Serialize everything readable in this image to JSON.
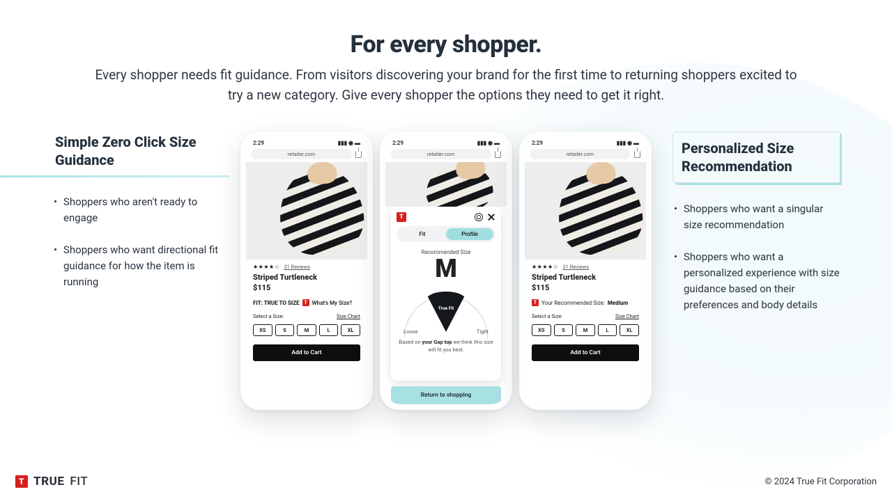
{
  "heading": {
    "title": "For every shopper.",
    "subtitle": "Every shopper needs fit guidance. From visitors discovering your brand for the first time to returning shoppers excited to try a new category. Give every shopper the options they need to get it right."
  },
  "left_panel": {
    "title": "Simple Zero Click Size Guidance",
    "bullets": [
      "Shoppers who aren't ready to engage",
      "Shoppers who want directional fit guidance for how the item is running"
    ]
  },
  "right_panel": {
    "title": "Personalized Size Recommendation",
    "bullets": [
      "Shoppers who want a singular size recommendation",
      "Shoppers who want a personalized experience with size guidance based on their preferences and body details"
    ]
  },
  "phone_common": {
    "status_time": "2:29",
    "url": "retailer.com",
    "product_name": "Striped Turtleneck",
    "price": "$115",
    "reviews": "31 Reviews",
    "select_label": "Select a Size:",
    "size_chart": "Size Chart",
    "sizes": [
      "XS",
      "S",
      "M",
      "L",
      "XL"
    ],
    "add_to_cart": "Add to Cart"
  },
  "phone1": {
    "fit_label": "FIT: TRUE TO SIZE",
    "whats_my_size": "What's My Size?"
  },
  "phone2": {
    "tabs": {
      "fit": "Fit",
      "profile": "Profile"
    },
    "rec_label": "Recommended Size",
    "rec_size": "M",
    "needle_label": "True Fit",
    "loose": "Loose",
    "tight": "Tight",
    "based_on_pre": "Based on ",
    "based_on_bold": "your Gap top",
    "based_on_post": " we think this size will fit you best.",
    "return": "Return to shopping"
  },
  "phone3": {
    "rec_prefix": "Your Recommended Size: ",
    "rec_value": "Medium"
  },
  "footer": {
    "brand_true": "TRUE",
    "brand_fit": "FIT",
    "copyright": "© 2024 True Fit Corporation"
  }
}
